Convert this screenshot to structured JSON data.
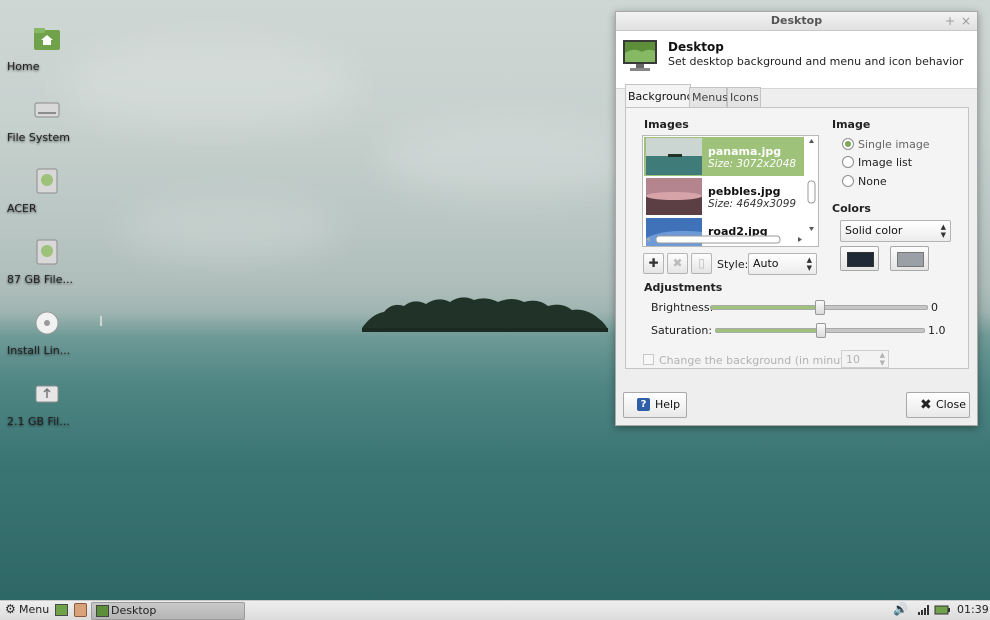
{
  "desktop": {
    "icons": [
      {
        "label": "Home",
        "icon": "home-folder-icon"
      },
      {
        "label": "File System",
        "icon": "drive-icon"
      },
      {
        "label": "ACER",
        "icon": "drive-icon"
      },
      {
        "label": "87 GB File...",
        "icon": "drive-icon"
      },
      {
        "label": "Install Lin...",
        "icon": "optical-disc-icon"
      },
      {
        "label": "2.1 GB Fil...",
        "icon": "usb-drive-icon"
      }
    ]
  },
  "dialog": {
    "window_title": "Desktop",
    "header_title": "Desktop",
    "header_subtitle": "Set desktop background and menu and icon behavior",
    "tabs": [
      "Background",
      "Menus",
      "Icons"
    ],
    "images_section": {
      "title": "Images",
      "items": [
        {
          "name": "panama.jpg",
          "size": "Size: 3072x2048",
          "selected": true
        },
        {
          "name": "pebbles.jpg",
          "size": "Size: 4649x3099",
          "selected": false
        },
        {
          "name": "road2.jpg",
          "size": "",
          "selected": false
        }
      ]
    },
    "style_label": "Style:",
    "style_value": "Auto",
    "image_section": {
      "title": "Image",
      "options": [
        "Single image",
        "Image list",
        "None"
      ],
      "selected": "Single image"
    },
    "colors_section": {
      "title": "Colors",
      "mode": "Solid color",
      "color1": "#1f2a36",
      "color2": "#9aa0a6"
    },
    "adjustments": {
      "title": "Adjustments",
      "brightness_label": "Brightness:",
      "brightness_value": "0",
      "brightness_level": 0.5,
      "saturation_label": "Saturation:",
      "saturation_value": "1.0",
      "saturation_level": 0.5
    },
    "change_background_label": "Change the background (in minutes):",
    "change_background_value": "10",
    "help_label": "Help",
    "close_label": "Close",
    "accent_color": "#9ec27a"
  },
  "taskbar": {
    "menu_label": "Menu",
    "window_button_label": "Desktop",
    "clock": "01:39"
  }
}
